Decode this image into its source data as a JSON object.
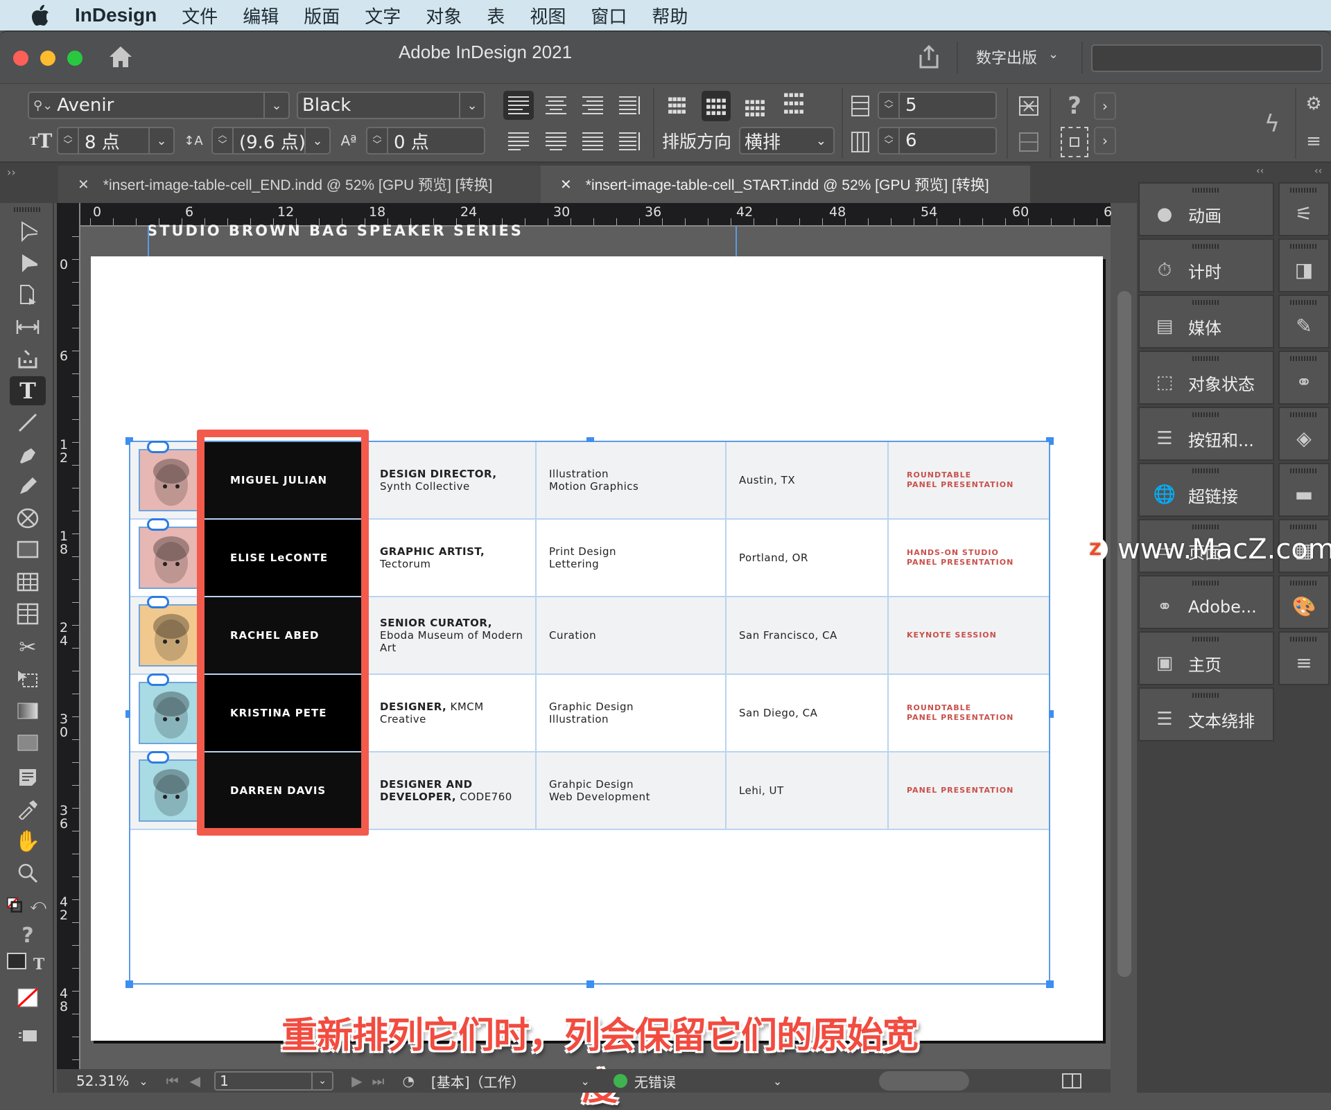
{
  "menubar": {
    "app_name": "InDesign",
    "items": [
      "文件",
      "编辑",
      "版面",
      "文字",
      "对象",
      "表",
      "视图",
      "窗口",
      "帮助"
    ]
  },
  "window": {
    "title": "Adobe InDesign 2021",
    "workspace": "数字出版",
    "search_placeholder": ""
  },
  "control": {
    "font_family": "Avenir",
    "font_style": "Black",
    "font_size": "8 点",
    "leading": "(9.6 点)",
    "baseline_shift": "0 点",
    "writing_direction_label": "排版方向",
    "writing_direction": "横排",
    "rows": "5",
    "columns": "6"
  },
  "tabs": [
    {
      "label": "*insert-image-table-cell_END.indd @ 52% [GPU 预览] [转换]",
      "active": false
    },
    {
      "label": "*insert-image-table-cell_START.indd @ 52% [GPU 预览] [转换]",
      "active": true
    }
  ],
  "rulers": {
    "horizontal": [
      "0",
      "6",
      "12",
      "18",
      "24",
      "30",
      "36",
      "42",
      "48",
      "54",
      "60",
      "6"
    ],
    "vertical": [
      "0",
      "6",
      "12",
      "18",
      "24",
      "30",
      "36",
      "42",
      "48"
    ]
  },
  "document": {
    "header": "STUDIO BROWN BAG SPEAKER SERIES",
    "rows": [
      {
        "name": "MIGUEL JULIAN",
        "role_bold": "DESIGN DIRECTOR,",
        "role_rest": "",
        "org": "Synth Collective",
        "skills": [
          "Illustration",
          "Motion Graphics"
        ],
        "location": "Austin, TX",
        "sessions": [
          "ROUNDTABLE",
          "PANEL PRESENTATION"
        ],
        "avatar_bg": "#e7b7b3",
        "shade": true
      },
      {
        "name": "ELISE LeCONTE",
        "role_bold": "GRAPHIC ARTIST,",
        "role_rest": "",
        "org": "Tectorum",
        "skills": [
          "Print Design",
          "Lettering"
        ],
        "location": "Portland, OR",
        "sessions": [
          "HANDS-ON STUDIO",
          "PANEL PRESENTATION"
        ],
        "avatar_bg": "#e7b7b3",
        "shade": false
      },
      {
        "name": "RACHEL ABED",
        "role_bold": "SENIOR CURATOR,",
        "role_rest": "",
        "org": "Eboda Museum of Modern Art",
        "skills": [
          "Curation"
        ],
        "location": "San Francisco, CA",
        "sessions": [
          "KEYNOTE SESSION"
        ],
        "avatar_bg": "#f1c98e",
        "shade": true
      },
      {
        "name": "KRISTINA PETE",
        "role_bold": "DESIGNER,",
        "role_rest": " KMCM",
        "org": "Creative",
        "skills": [
          "Graphic Design",
          "Illustration"
        ],
        "location": "San Diego, CA",
        "sessions": [
          "ROUNDTABLE",
          "PANEL PRESENTATION"
        ],
        "avatar_bg": "#a8dbe3",
        "shade": false
      },
      {
        "name": "DARREN DAVIS",
        "role_bold": "DESIGNER AND DEVELOPER,",
        "role_rest": " CODE760",
        "org": "",
        "skills": [
          "Grahpic Design",
          "Web Development"
        ],
        "location": "Lehi, UT",
        "sessions": [
          "PANEL PRESENTATION"
        ],
        "avatar_bg": "#a8dbe3",
        "shade": true
      }
    ]
  },
  "panels": {
    "main": [
      "动画",
      "计时",
      "媒体",
      "对象状态",
      "按钮和...",
      "超链接",
      "页面",
      "Adobe...",
      "主页",
      "文本绕排"
    ]
  },
  "status": {
    "zoom": "52.31%",
    "page": "1",
    "profile": "[基本]（工作）",
    "preflight": "无错误",
    "preflight_color": "#3fb34f"
  },
  "caption": "重新排列它们时，列会保留它们的原始宽度",
  "watermark": "www.MacZ.com",
  "colors": {
    "accent_selection": "#3d8ef0",
    "highlight_box": "#f25a4c",
    "session_text": "#c8504b"
  }
}
